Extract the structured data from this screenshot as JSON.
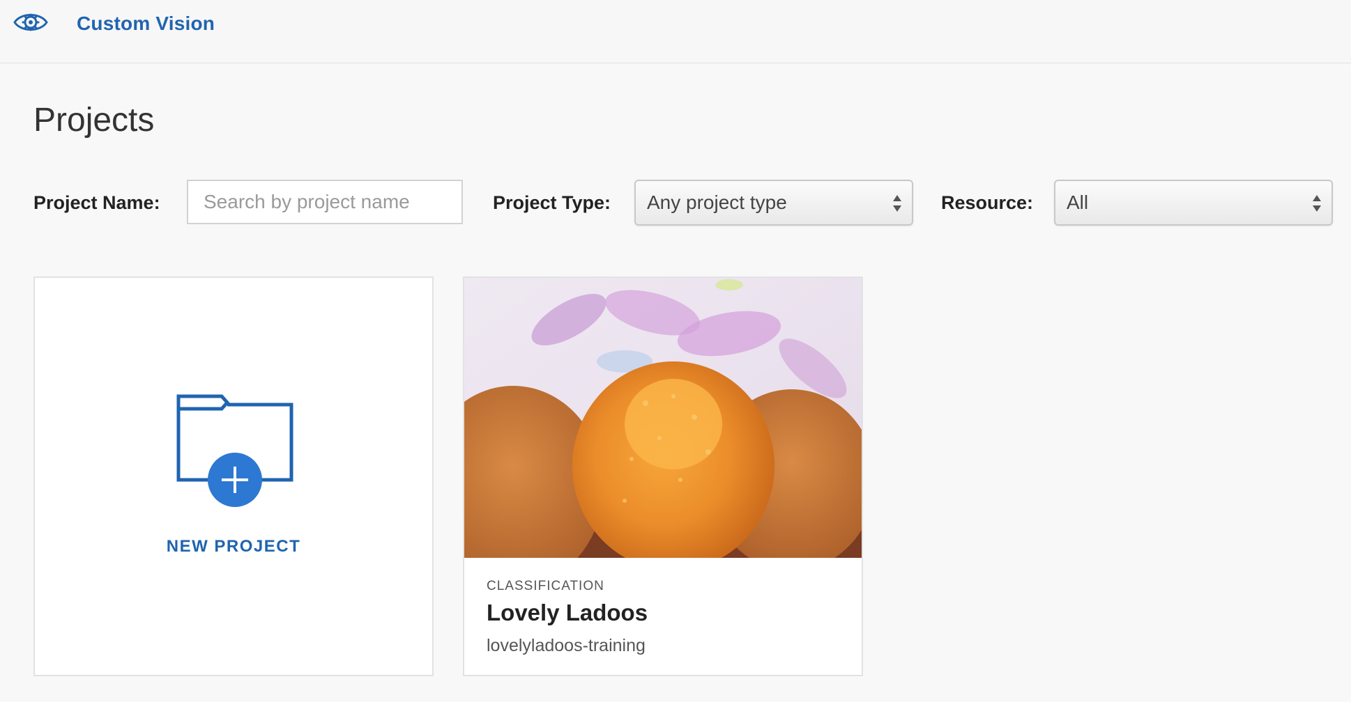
{
  "app": {
    "brand": "Custom Vision",
    "logo_icon": "eye-gear-icon",
    "accent_color": "#2064b0"
  },
  "page": {
    "title": "Projects"
  },
  "filters": {
    "name_label": "Project Name:",
    "name_placeholder": "Search by project name",
    "name_value": "",
    "type_label": "Project Type:",
    "type_selected": "Any project type",
    "resource_label": "Resource:",
    "resource_selected": "All"
  },
  "new_project": {
    "label": "NEW PROJECT",
    "icon": "folder-add-icon"
  },
  "projects": [
    {
      "type": "CLASSIFICATION",
      "name": "Lovely Ladoos",
      "resource": "lovelyladoos-training",
      "thumbnail": "ladoo-photo"
    }
  ]
}
